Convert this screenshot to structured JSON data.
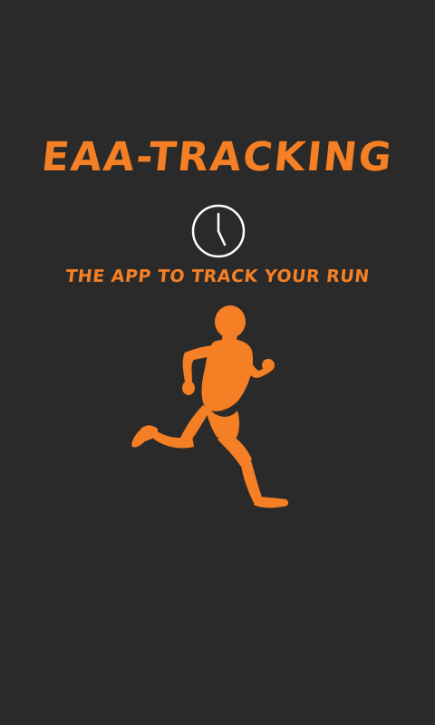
{
  "splash": {
    "title": "EAA-TRACKING",
    "tagline": "THE APP TO TRACK YOUR RUN",
    "icons": {
      "clock": "clock-icon",
      "runner": "runner-icon"
    },
    "colors": {
      "background": "#2a2a2a",
      "accent": "#f47f24",
      "clock_stroke": "#ffffff"
    }
  }
}
